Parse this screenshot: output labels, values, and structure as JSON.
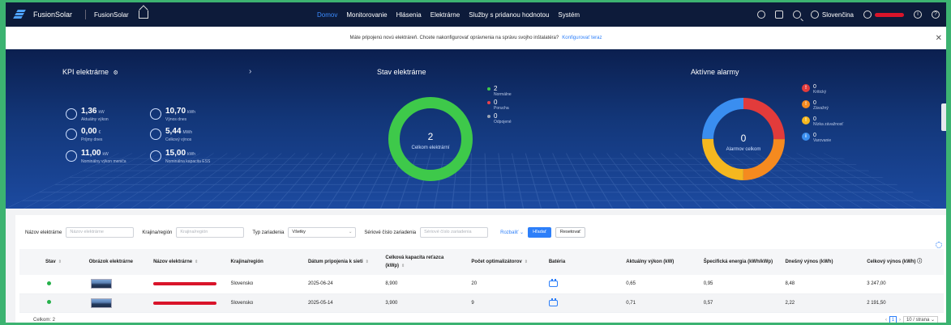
{
  "app": {
    "brand": "FusionSolar",
    "brand_sub": "FusionSolar"
  },
  "nav": {
    "items": [
      {
        "label": "Domov",
        "active": true
      },
      {
        "label": "Monitorovanie",
        "active": false
      },
      {
        "label": "Hlásenia",
        "active": false
      },
      {
        "label": "Elektrárne",
        "active": false
      },
      {
        "label": "Služby s pridanou hodnotou",
        "active": false
      },
      {
        "label": "Systém",
        "active": false
      }
    ],
    "language": "Slovenčina",
    "icons": [
      "chat-icon",
      "calendar-icon",
      "search-icon",
      "globe-icon",
      "user-icon",
      "info-icon",
      "help-icon"
    ]
  },
  "banner": {
    "text": "Máte pripojenú novú elektráreň. Chcete nakonfigurovať oprávnenia na správu svojho inštalatéra?",
    "link": "Konfigurovať teraz"
  },
  "kpi": {
    "title": "KPI elektrárne",
    "items": [
      {
        "value": "1,36",
        "unit": "kW",
        "label": "Aktuálny výkon"
      },
      {
        "value": "10,70",
        "unit": "kWh",
        "label": "Výnos dnes"
      },
      {
        "value": "0,00",
        "unit": "€",
        "label": "Príjmy dnes"
      },
      {
        "value": "5,44",
        "unit": "MWh",
        "label": "Celkový výnos"
      },
      {
        "value": "11,00",
        "unit": "kW",
        "label": "Nominálny výkon meniča"
      },
      {
        "value": "15,00",
        "unit": "kWh",
        "label": "Nominálna kapacita ESS"
      }
    ]
  },
  "plant_status": {
    "title": "Stav elektrárne",
    "total": "2",
    "total_label": "Celkom elektrární",
    "legend": [
      {
        "value": "2",
        "label": "Normálne",
        "color": "#3ec94a"
      },
      {
        "value": "0",
        "label": "Porucha",
        "color": "#e8414c"
      },
      {
        "value": "0",
        "label": "Odpojené",
        "color": "#9aa3b5"
      }
    ]
  },
  "alarms": {
    "title": "Aktívne alarmy",
    "total": "0",
    "total_label": "Alarmov celkom",
    "items": [
      {
        "value": "0",
        "label": "Kritický",
        "color": "#e23b3b",
        "icon": "!"
      },
      {
        "value": "0",
        "label": "Závažný",
        "color": "#f58a1f",
        "icon": "!"
      },
      {
        "value": "0",
        "label": "Nízka závažnosť",
        "color": "#f5b71f",
        "icon": "!"
      },
      {
        "value": "0",
        "label": "Varovanie",
        "color": "#3a8ef0",
        "icon": "i"
      }
    ],
    "ring_colors": [
      "#e23b3b",
      "#f58a1f",
      "#f5b71f",
      "#3a8ef0"
    ]
  },
  "filters": {
    "name_label": "Názov elektrárne",
    "name_placeholder": "Názov elektrárne",
    "region_label": "Krajina/región",
    "region_placeholder": "Krajina/región",
    "type_label": "Typ zariadenia",
    "type_value": "Všetky",
    "serial_label": "Sériové číslo zariadenia",
    "serial_placeholder": "Sériové číslo zariadenia",
    "expand": "Rozbaliť",
    "search": "Hľadať",
    "reset": "Resetovať"
  },
  "table": {
    "columns": [
      "Stav",
      "Obrázok elektrárne",
      "Názov elektrárne",
      "Krajina/región",
      "Dátum pripojenia k sieti",
      "Celková kapacita reťazca (kWp)",
      "Počet optimalizátorov",
      "Batéria",
      "Aktuálny výkon (kW)",
      "Špecifická energia (kWh/kWp)",
      "Dnešný výnos (kWh)",
      "Celkový výnos (kWh)"
    ],
    "rows": [
      {
        "region": "Slovensko",
        "date": "2025-06-24",
        "capacity": "8,900",
        "optimizers": "20",
        "power": "0,65",
        "specific": "0,95",
        "today": "8,48",
        "total": "3 247,00"
      },
      {
        "region": "Slovensko",
        "date": "2025-05-14",
        "capacity": "3,900",
        "optimizers": "9",
        "power": "0,71",
        "specific": "0,57",
        "today": "2,22",
        "total": "2 191,50"
      }
    ],
    "total_text": "Celkom: 2",
    "page": "1",
    "page_size": "10 / strana"
  }
}
